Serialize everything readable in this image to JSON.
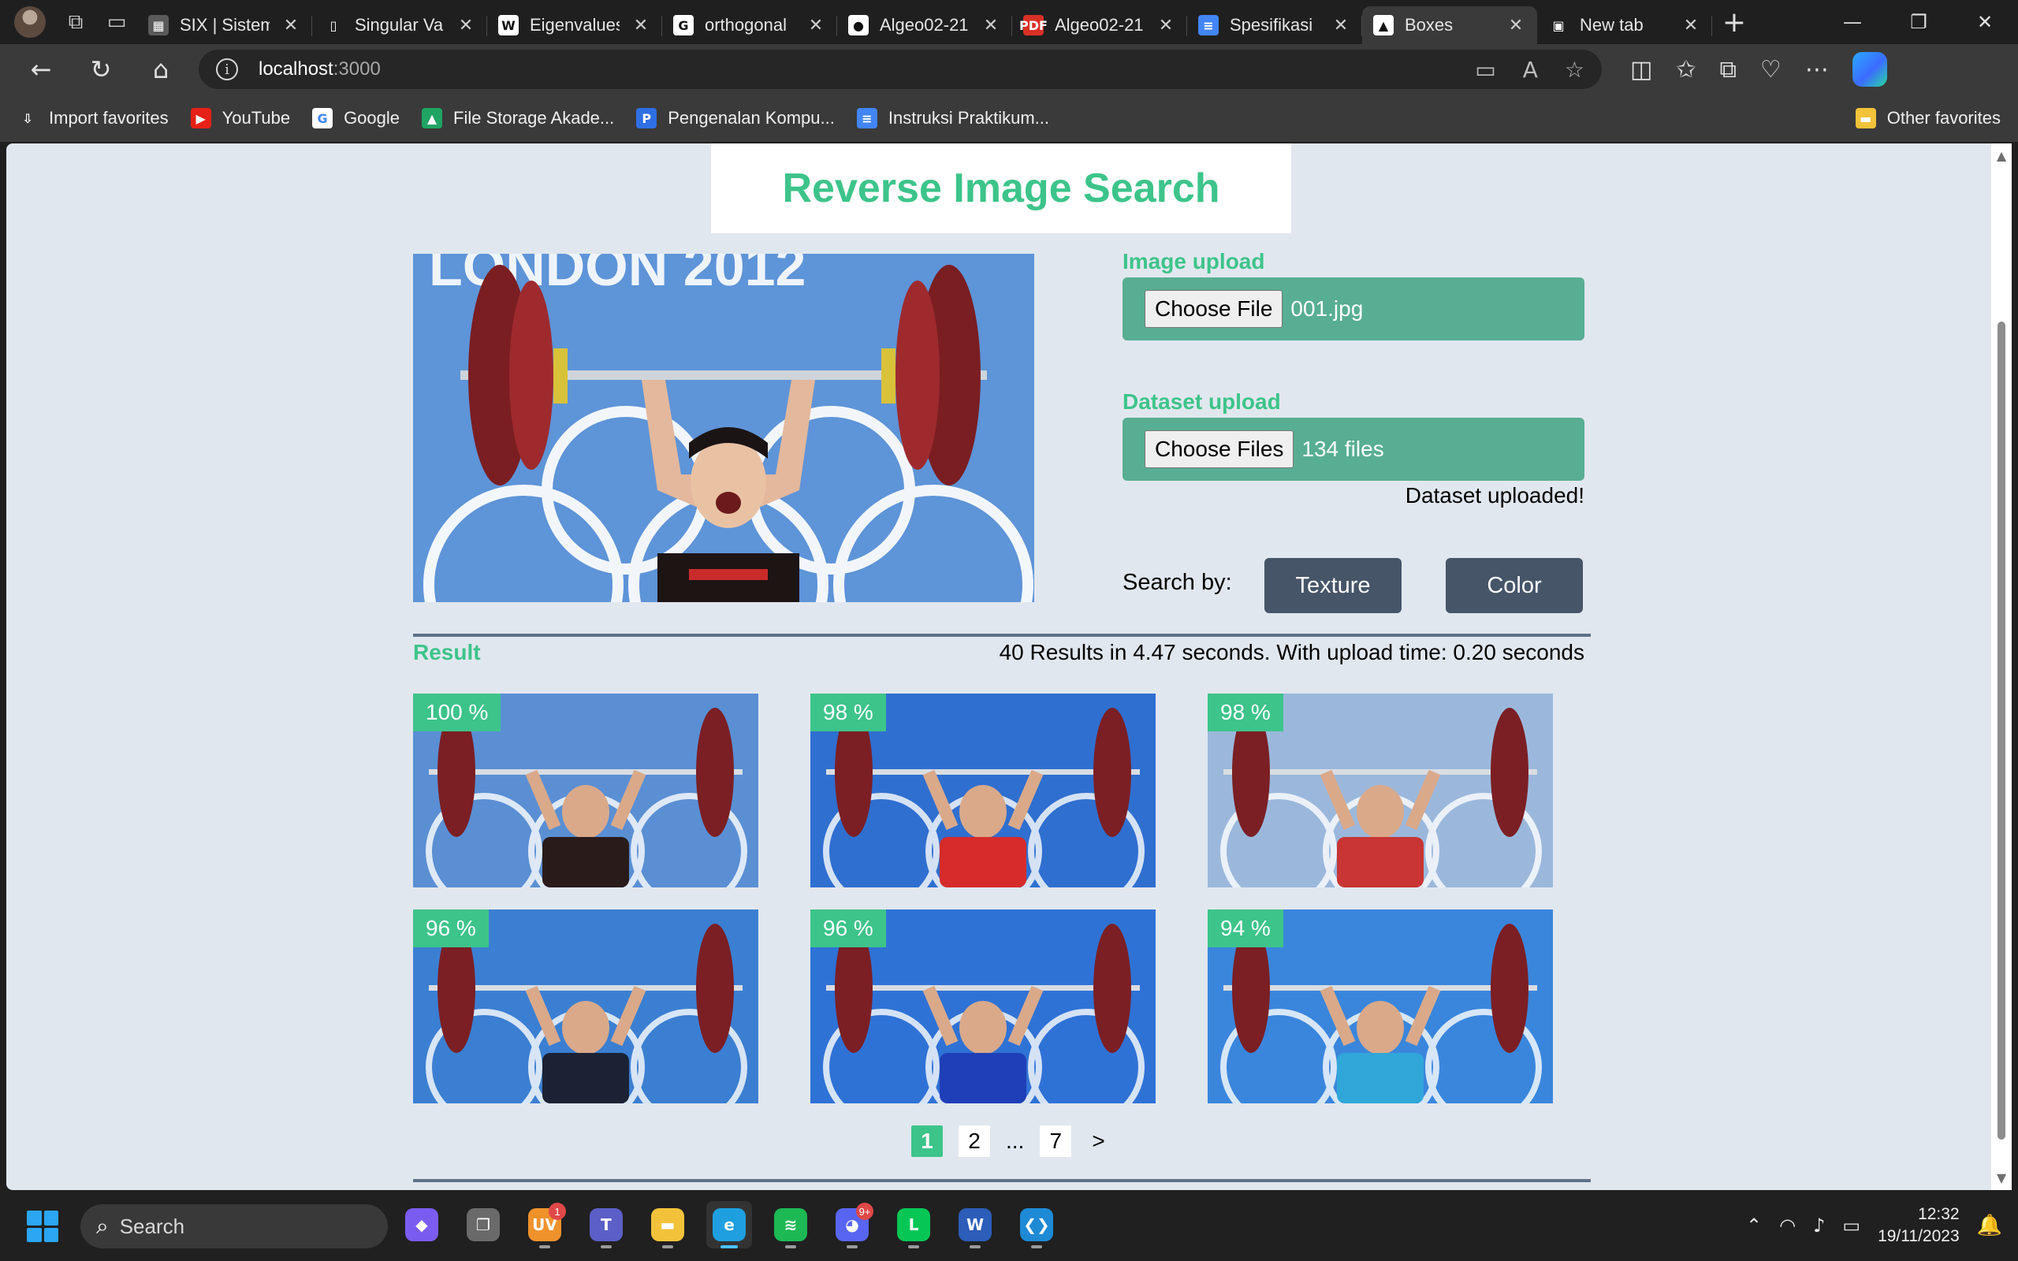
{
  "browser": {
    "tabs": [
      {
        "title": "SIX | Sistem",
        "favicon_color": "#5a5a5a",
        "favicon_glyph": "▦"
      },
      {
        "title": "Singular Va",
        "favicon_color": "#1f1f1f",
        "favicon_glyph": "▯"
      },
      {
        "title": "Eigenvalues",
        "favicon_color": "#ffffff",
        "favicon_glyph": "W"
      },
      {
        "title": "orthogonal",
        "favicon_color": "#ffffff",
        "favicon_glyph": "G"
      },
      {
        "title": "Algeo02-21",
        "favicon_color": "#ffffff",
        "favicon_glyph": "●"
      },
      {
        "title": "Algeo02-21",
        "favicon_color": "#d93025",
        "favicon_glyph": "PDF"
      },
      {
        "title": "Spesifikasi",
        "favicon_color": "#4285f4",
        "favicon_glyph": "≡"
      },
      {
        "title": "Boxes",
        "favicon_color": "#ffffff",
        "favicon_glyph": "▲",
        "active": true
      },
      {
        "title": "New tab",
        "favicon_color": "#1f1f1f",
        "favicon_glyph": "▣"
      }
    ],
    "url_host": "localhost",
    "url_port": ":3000",
    "bookmarks": [
      {
        "label": "Import favorites",
        "icon": "import-icon",
        "color": "#3a3a3a",
        "glyph": "⇩"
      },
      {
        "label": "YouTube",
        "icon": "youtube-icon",
        "color": "#e62117",
        "glyph": "▶"
      },
      {
        "label": "Google",
        "icon": "google-icon",
        "color": "#ffffff",
        "glyph": "G"
      },
      {
        "label": "File Storage Akade...",
        "icon": "drive-icon",
        "color": "#1fa463",
        "glyph": "▲"
      },
      {
        "label": "Pengenalan Kompu...",
        "icon": "p-icon",
        "color": "#2f6fe4",
        "glyph": "P"
      },
      {
        "label": "Instruksi Praktikum...",
        "icon": "docs-icon",
        "color": "#4285f4",
        "glyph": "≡"
      }
    ],
    "other_favorites": "Other favorites"
  },
  "app": {
    "title": "Reverse Image Search",
    "image_upload": {
      "label": "Image upload",
      "button": "Choose File",
      "value": "001.jpg"
    },
    "dataset_upload": {
      "label": "Dataset upload",
      "button": "Choose Files",
      "value": "134 files",
      "status": "Dataset uploaded!"
    },
    "search_by": {
      "label": "Search by:",
      "texture": "Texture",
      "color": "Color"
    },
    "result": {
      "label": "Result",
      "stats": "40 Results in 4.47 seconds. With upload time: 0.20 seconds",
      "items": [
        {
          "similarity": "100 %",
          "jersey": "#2a1b1b",
          "bg": "#5a8fd4"
        },
        {
          "similarity": "98 %",
          "jersey": "#d62b2b",
          "bg": "#2f6fd0"
        },
        {
          "similarity": "98 %",
          "jersey": "#c93434",
          "bg": "#9bb8dc"
        },
        {
          "similarity": "96 %",
          "jersey": "#1b2233",
          "bg": "#3b7fd2"
        },
        {
          "similarity": "96 %",
          "jersey": "#1f3fb8",
          "bg": "#2f72d6"
        },
        {
          "similarity": "94 %",
          "jersey": "#30a7d8",
          "bg": "#3a86dd"
        }
      ]
    },
    "pagination": {
      "current": "1",
      "next_page": "2",
      "ellipsis": "...",
      "last": "7",
      "next": ">"
    }
  },
  "taskbar": {
    "search_placeholder": "Search",
    "time": "12:32",
    "date": "19/11/2023",
    "apps": [
      {
        "name": "copilot-app-icon",
        "color": "#7b5cf0",
        "glyph": "◆"
      },
      {
        "name": "task-view-icon",
        "color": "#6a6a6a",
        "glyph": "❐"
      },
      {
        "name": "uv-app-icon",
        "color": "#f0922c",
        "glyph": "UV",
        "badge": "1"
      },
      {
        "name": "teams-icon",
        "color": "#5b5fc7",
        "glyph": "T"
      },
      {
        "name": "file-explorer-icon",
        "color": "#f2c33a",
        "glyph": "▬"
      },
      {
        "name": "edge-icon",
        "color": "#1f9fe0",
        "glyph": "e",
        "active": true
      },
      {
        "name": "spotify-icon",
        "color": "#1db954",
        "glyph": "≋"
      },
      {
        "name": "discord-icon",
        "color": "#5865f2",
        "glyph": "◕",
        "badge": "9+"
      },
      {
        "name": "line-icon",
        "color": "#06c755",
        "glyph": "L"
      },
      {
        "name": "word-icon",
        "color": "#2b5db9",
        "glyph": "W"
      },
      {
        "name": "vscode-icon",
        "color": "#1e8ad6",
        "glyph": "❮❯"
      }
    ]
  }
}
